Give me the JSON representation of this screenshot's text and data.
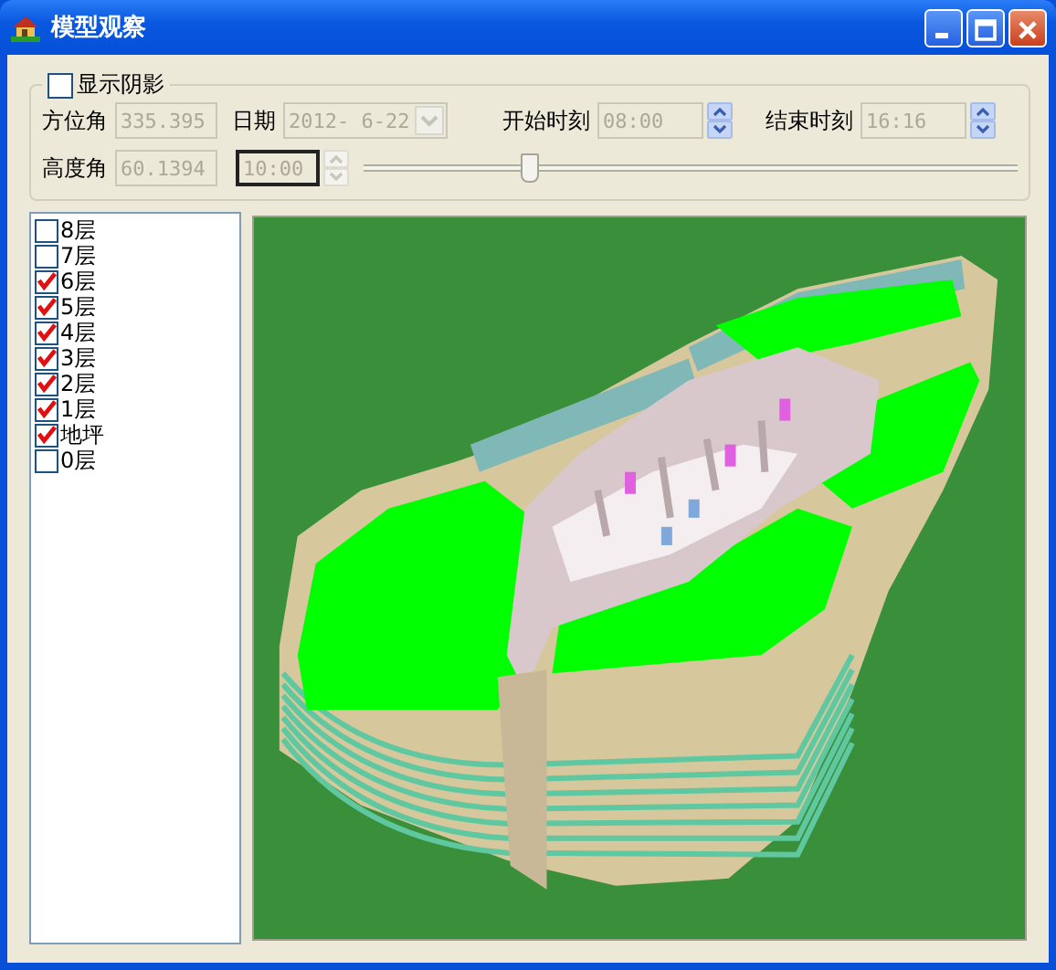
{
  "window": {
    "title": "模型观察"
  },
  "shadow": {
    "label": "显示阴影",
    "checked": false
  },
  "fields": {
    "azimuth": {
      "label": "方位角",
      "value": "335.395",
      "disabled": true
    },
    "date": {
      "label": "日期",
      "value": "2012- 6-22",
      "disabled": true
    },
    "start_time": {
      "label": "开始时刻",
      "value": "08:00",
      "disabled": true
    },
    "end_time": {
      "label": "结束时刻",
      "value": "16:16",
      "disabled": true
    },
    "altitude": {
      "label": "高度角",
      "value": "60.1394",
      "disabled": true
    },
    "current_time": {
      "value": "10:00",
      "disabled": true
    }
  },
  "time_slider": {
    "level": 0.25
  },
  "floors": [
    {
      "label": "8层",
      "checked": false
    },
    {
      "label": "7层",
      "checked": false
    },
    {
      "label": "6层",
      "checked": true
    },
    {
      "label": "5层",
      "checked": true
    },
    {
      "label": "4层",
      "checked": true
    },
    {
      "label": "3层",
      "checked": true
    },
    {
      "label": "2层",
      "checked": true
    },
    {
      "label": "1层",
      "checked": true
    },
    {
      "label": "地坪",
      "checked": true
    },
    {
      "label": "0层",
      "checked": false
    }
  ]
}
